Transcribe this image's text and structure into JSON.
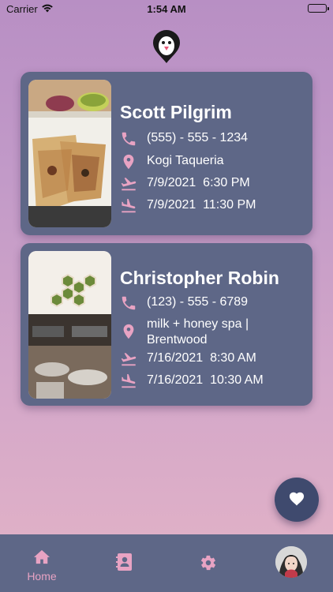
{
  "status_bar": {
    "carrier": "Carrier",
    "time": "1:54 AM"
  },
  "colors": {
    "card_bg": "#5e6787",
    "accent_pink": "#e8a3c3",
    "fab_bg": "#3f4a6e"
  },
  "cards": [
    {
      "name": "Scott Pilgrim",
      "phone": "(555) - 555 - 1234",
      "location": "Kogi Taqueria",
      "departure": "7/9/2021  6:30 PM",
      "arrival": "7/9/2021  11:30 PM",
      "photo_icon": "food-photo"
    },
    {
      "name": "Christopher Robin",
      "phone": "(123) - 555 - 6789",
      "location": "milk + honey spa |\nBrentwood",
      "departure": "7/16/2021  8:30 AM",
      "arrival": "7/16/2021  10:30 AM",
      "photo_icon": "spa-interior-photo"
    }
  ],
  "tabbar": {
    "items": [
      {
        "label": "Home",
        "icon": "home-icon",
        "active": true
      },
      {
        "label": "",
        "icon": "contacts-icon",
        "active": false
      },
      {
        "label": "",
        "icon": "gear-icon",
        "active": false
      },
      {
        "label": "",
        "icon": "avatar",
        "active": false
      }
    ]
  },
  "fab": {
    "icon": "heart-icon"
  }
}
